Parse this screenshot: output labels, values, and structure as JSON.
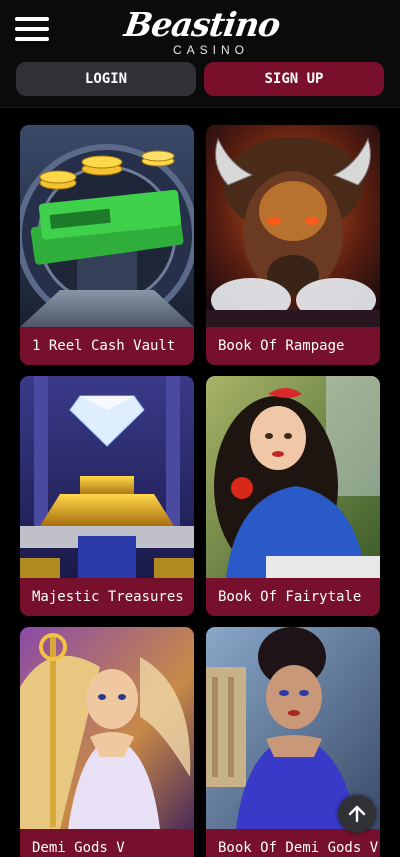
{
  "header": {
    "logo_text": "Beastino",
    "logo_sub": "CASINO",
    "login_label": "LOGIN",
    "signup_label": "SIGN UP"
  },
  "games": [
    {
      "title": "1 Reel Cash Vault",
      "art": "vault-money-image"
    },
    {
      "title": "Book Of Rampage",
      "art": "buffalo-image"
    },
    {
      "title": "Majestic Treasures",
      "art": "diamond-pedestal-image"
    },
    {
      "title": "Book Of Fairytale",
      "art": "princess-apple-image"
    },
    {
      "title": "Demi Gods V",
      "art": "goddess-staff-image"
    },
    {
      "title": "Book Of Demi Gods V",
      "art": "goddess-blue-dress-image"
    }
  ],
  "icons": {
    "menu": "hamburger-menu-icon",
    "scroll_top": "arrow-up-icon"
  },
  "colors": {
    "accent": "#7a0f2c",
    "button_dark": "#2f3134",
    "background": "#000000"
  }
}
